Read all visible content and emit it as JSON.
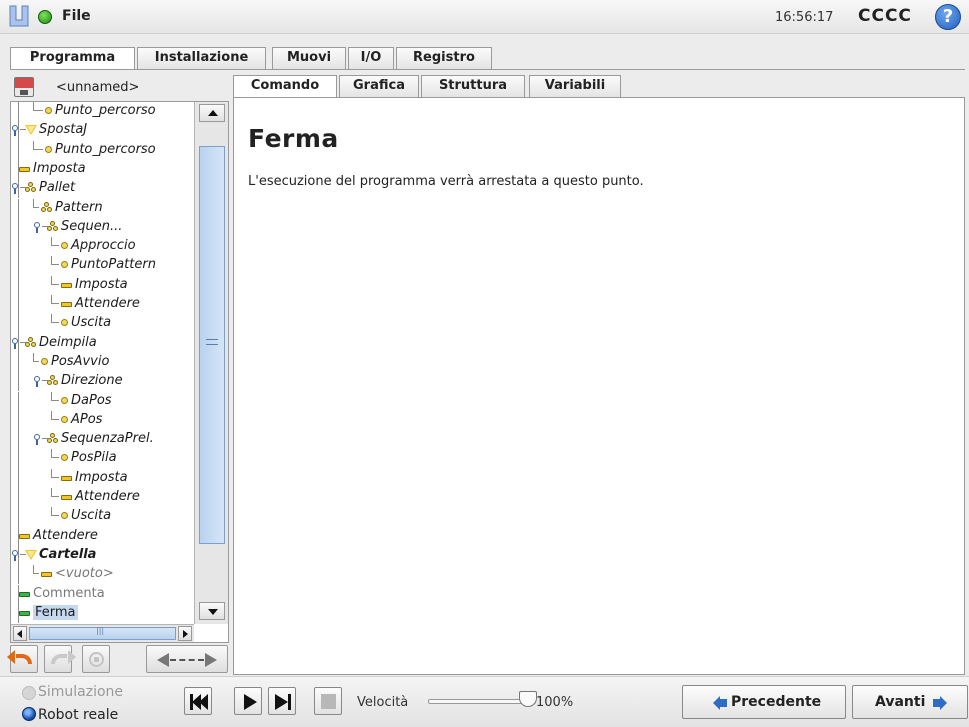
{
  "topbar": {
    "file_label": "File",
    "time": "16:56:17",
    "robot_name": "CCCC",
    "help_label": "?"
  },
  "main_tabs": [
    {
      "label": "Programma",
      "active": true
    },
    {
      "label": "Installazione",
      "active": false
    },
    {
      "label": "Muovi",
      "active": false
    },
    {
      "label": "I/O",
      "active": false
    },
    {
      "label": "Registro",
      "active": false
    }
  ],
  "program": {
    "name": "<unnamed>"
  },
  "tree": [
    {
      "label": "Punto_percorso",
      "icon": "waypoint"
    },
    {
      "label": "SpostaJ",
      "icon": "move"
    },
    {
      "label": "Punto_percorso",
      "icon": "waypoint"
    },
    {
      "label": "Imposta",
      "icon": "set"
    },
    {
      "label": "Pallet",
      "icon": "pattern"
    },
    {
      "label": "Pattern",
      "icon": "pattern"
    },
    {
      "label": "Sequen...",
      "icon": "pattern"
    },
    {
      "label": "Approccio",
      "icon": "waypoint"
    },
    {
      "label": "PuntoPattern",
      "icon": "waypoint"
    },
    {
      "label": "Imposta",
      "icon": "set"
    },
    {
      "label": "Attendere",
      "icon": "set"
    },
    {
      "label": "Uscita",
      "icon": "waypoint"
    },
    {
      "label": "Deimpila",
      "icon": "pattern"
    },
    {
      "label": "PosAvvio",
      "icon": "waypoint"
    },
    {
      "label": "Direzione",
      "icon": "pattern"
    },
    {
      "label": "DaPos",
      "icon": "waypoint"
    },
    {
      "label": "APos",
      "icon": "waypoint"
    },
    {
      "label": "SequenzaPrel.",
      "icon": "pattern"
    },
    {
      "label": "PosPila",
      "icon": "waypoint"
    },
    {
      "label": "Imposta",
      "icon": "set"
    },
    {
      "label": "Attendere",
      "icon": "set"
    },
    {
      "label": "Uscita",
      "icon": "waypoint"
    },
    {
      "label": "Attendere",
      "icon": "set"
    },
    {
      "label": "Cartella",
      "icon": "move"
    },
    {
      "label": "<vuoto>",
      "icon": "set"
    },
    {
      "label": "Commenta",
      "icon": "set-green"
    },
    {
      "label": "Ferma",
      "icon": "set-green",
      "selected": true
    }
  ],
  "sub_tabs": [
    {
      "label": "Comando",
      "active": true
    },
    {
      "label": "Grafica",
      "active": false
    },
    {
      "label": "Struttura",
      "active": false
    },
    {
      "label": "Variabili",
      "active": false
    }
  ],
  "command": {
    "title": "Ferma",
    "description": "L'esecuzione del programma verrà arrestata a questo punto."
  },
  "footer": {
    "simulation_label": "Simulazione",
    "real_robot_label": "Robot reale",
    "speed_label": "Velocità",
    "speed_value": "100%",
    "speed_fraction": 1.0,
    "prev_label": "Precedente",
    "next_label": "Avanti"
  }
}
